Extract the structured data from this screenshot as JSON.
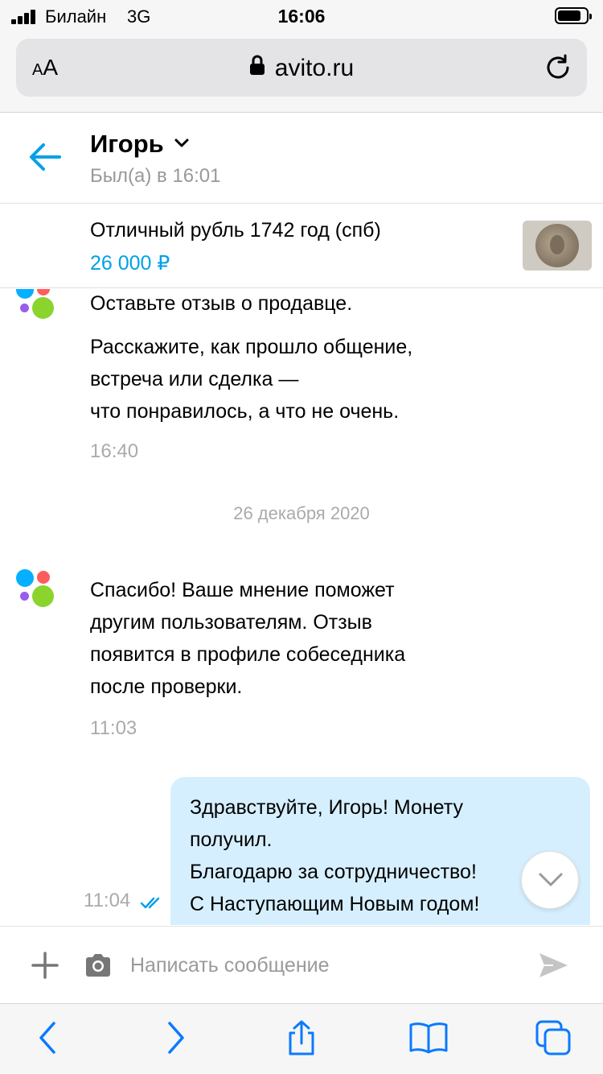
{
  "status_bar": {
    "carrier": "Билайн",
    "network": "3G",
    "time": "16:06"
  },
  "browser": {
    "aa_small": "A",
    "aa_large": "A",
    "url": "avito.ru"
  },
  "chat_header": {
    "contact_name": "Игорь",
    "last_seen": "Был(а) в 16:01"
  },
  "item": {
    "title": "Отличный рубль 1742 год (спб)",
    "price": "26 000 ₽"
  },
  "messages": {
    "system_review": {
      "line1": "Оставьте отзыв о продавце.",
      "line2": "Расскажите, как прошло общение,",
      "line3": "встреча или сделка —",
      "line4": "что понравилось, а что не очень.",
      "time": "16:40"
    },
    "date_separator": "26 декабря 2020",
    "system_thanks": {
      "line1": "Спасибо! Ваше мнение поможет",
      "line2": "другим пользователям. Отзыв",
      "line3": "появится в профиле собеседника",
      "line4": "после проверки.",
      "time": "11:03"
    },
    "outgoing": {
      "line1": "Здравствуйте, Игорь! Монету",
      "line2": "получил.",
      "line3": "Благодарю за сотрудничество!",
      "line4": "С Наступающим Новым годом!",
      "time": "11:04"
    }
  },
  "composer": {
    "placeholder": "Написать сообщение"
  },
  "colors": {
    "accent": "#00a1e6",
    "outgoing_bubble": "#d6efff",
    "muted_text": "#aaaaaa"
  },
  "icons": [
    "signal-icon",
    "battery-icon",
    "lock-icon",
    "reload-icon",
    "back-arrow-icon",
    "chevron-down-icon",
    "avito-logo",
    "double-check-icon",
    "scroll-down-icon",
    "plus-icon",
    "camera-icon",
    "send-icon",
    "safari-back-icon",
    "safari-forward-icon",
    "share-icon",
    "bookmarks-icon",
    "tabs-icon"
  ]
}
